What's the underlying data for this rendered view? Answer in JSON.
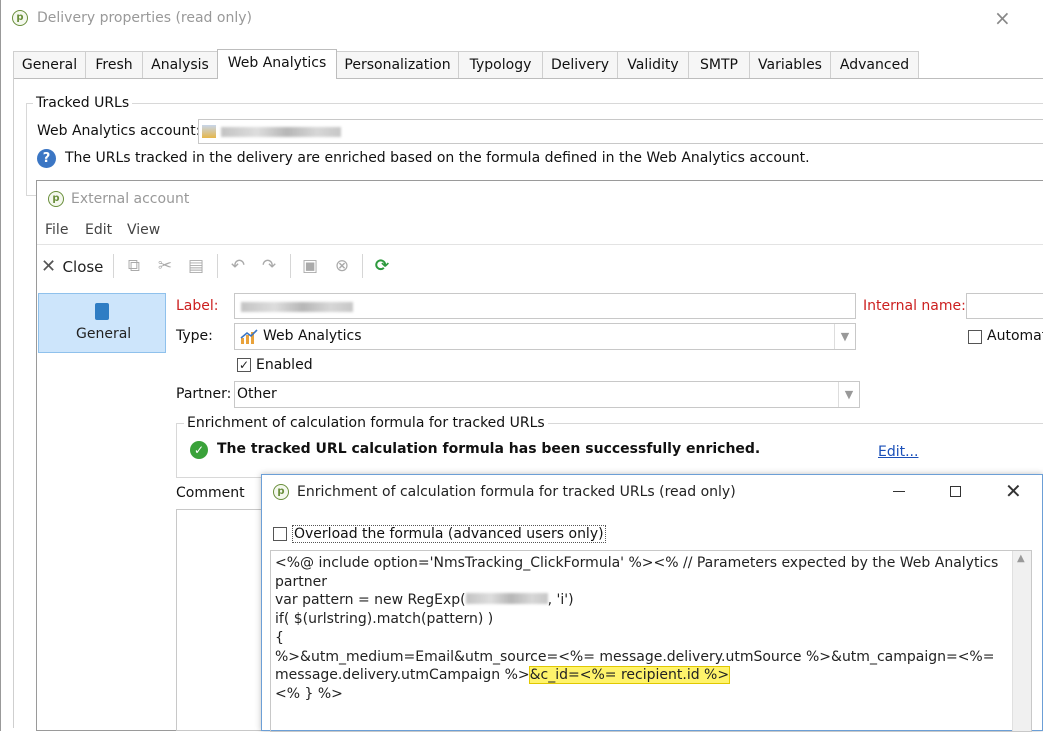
{
  "main_window": {
    "title": "Delivery properties (read only)",
    "close_glyph": "×",
    "tabs": [
      "General",
      "Fresh",
      "Analysis",
      "Web Analytics",
      "Personalization",
      "Typology",
      "Delivery",
      "Validity",
      "SMTP",
      "Variables",
      "Advanced"
    ],
    "active_tab": "Web Analytics",
    "tracked_group_label": "Tracked URLs",
    "account_label": "Web Analytics account:",
    "info_text": "The URLs tracked in the delivery are enriched based on the formula defined in the Web Analytics account."
  },
  "external_account": {
    "title": "External account",
    "menu": [
      "File",
      "Edit",
      "View"
    ],
    "close_label": "Close",
    "nav_general": "General",
    "label_label": "Label:",
    "internal_name_label": "Internal name:",
    "type_label": "Type:",
    "type_value": "Web Analytics",
    "automatic_label": "Automat",
    "enabled_label": "Enabled",
    "partner_label": "Partner:",
    "partner_value": "Other",
    "enrichment_group_label": "Enrichment of calculation formula for tracked URLs",
    "success_text": "The tracked URL calculation formula has been successfully enriched.",
    "edit_link": "Edit...",
    "comment_label": "Comment"
  },
  "formula_dialog": {
    "title": "Enrichment of calculation formula for tracked URLs (read only)",
    "overload_label": "Overload the formula (advanced users only)",
    "code_lines": [
      "<%@ include option='NmsTracking_ClickFormula' %><% // Parameters expected by the Web Analytics",
      "partner",
      "var pattern = new RegExp(",
      "if( $(urlstring).match(pattern) )",
      "{",
      "%>&utm_medium=Email&utm_source=<%= message.delivery.utmSource %>&utm_campaign=<%=",
      "message.delivery.utmCampaign %>",
      "<% } %>"
    ],
    "regexp_tail": ", 'i')",
    "highlight": "&c_id=<%= recipient.id %>",
    "colors": {
      "highlight": "#fff36b",
      "link": "#1a4fb8",
      "required_label": "#cc1f1f",
      "success": "#3aa23a",
      "info": "#3b76c4"
    }
  }
}
